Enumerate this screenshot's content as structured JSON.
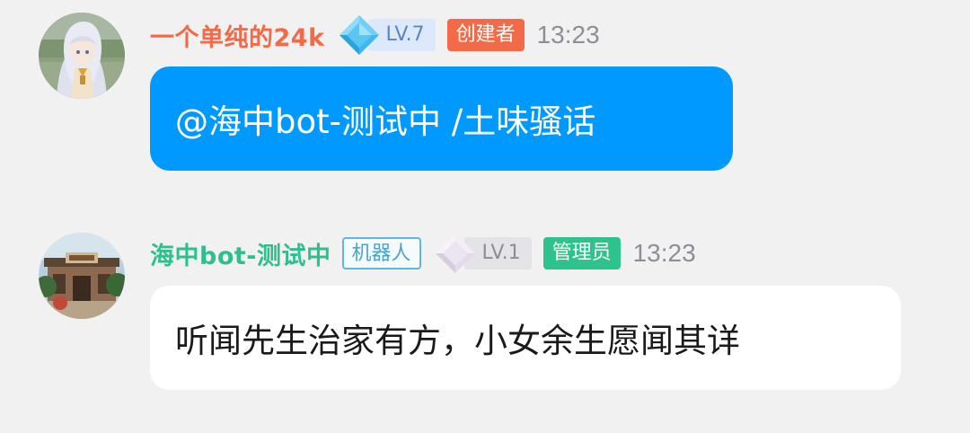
{
  "messages": [
    {
      "username": "一个单纯的24k",
      "username_color": "#f26a47",
      "level": "LV.7",
      "role": "创建者",
      "role_color": "#f26a47",
      "time": "13:23",
      "text": "@海中bot-测试中 /土味骚话",
      "bubble_color": "#0099ff",
      "avatar_icon": "anime-girl-avatar",
      "level_icon": "blue-diamond-icon"
    },
    {
      "username": "海中bot-测试中",
      "username_color": "#2fbf8f",
      "bot_tag": "机器人",
      "level": "LV.1",
      "role": "管理员",
      "role_color": "#2ec28c",
      "time": "13:23",
      "text": "听闻先生治家有方，小女余生愿闻其详",
      "bubble_color": "#ffffff",
      "avatar_icon": "building-gate-avatar",
      "level_icon": "gray-diamond-icon"
    }
  ],
  "colors": {
    "background": "#f1f1f2",
    "time_text": "#8e8e96"
  }
}
